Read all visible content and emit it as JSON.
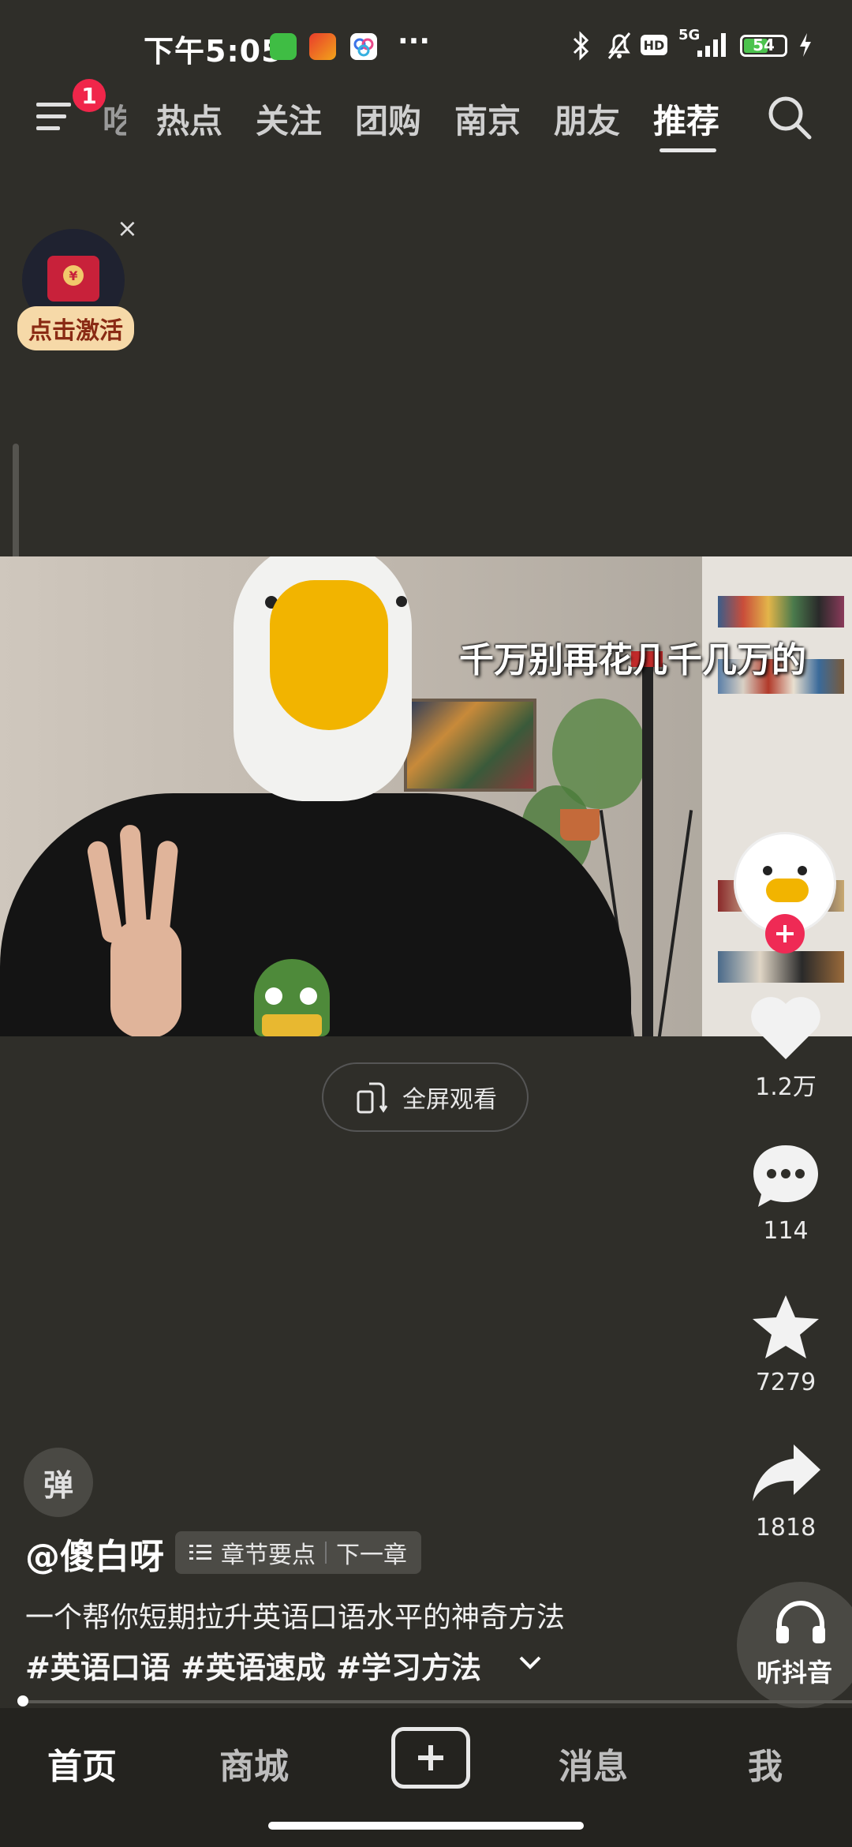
{
  "status_bar": {
    "time": "下午5:05",
    "more": "···",
    "network": "5G",
    "battery": "54"
  },
  "top_nav": {
    "badge": "1",
    "partial_tab": "吃",
    "tabs": [
      "热点",
      "关注",
      "团购",
      "南京",
      "朋友",
      "推荐"
    ],
    "active_tab": "推荐"
  },
  "red_packet": {
    "label": "点击激活",
    "close": "×",
    "symbol": "¥"
  },
  "video": {
    "subtitle": "千万别再花几千几万的"
  },
  "fullscreen": {
    "label": "全屏观看"
  },
  "rail": {
    "likes": "1.2万",
    "comments": "114",
    "favorites": "7279",
    "shares": "1818",
    "listen_label": "听抖音"
  },
  "info": {
    "danmu": "弹",
    "author": "@傻白呀",
    "chapter_points": "章节要点",
    "next_chapter": "下一章",
    "description": "一个帮你短期拉升英语口语水平的神奇方法",
    "hashtags": "#英语口语 #英语速成 #学习方法"
  },
  "bottom_nav": {
    "home": "首页",
    "mall": "商城",
    "messages": "消息",
    "me": "我"
  },
  "colors": {
    "background": "#2f2e29",
    "badge_red": "#f0264a",
    "follow_red": "#ef2a55",
    "duck_yellow": "#f2b400"
  }
}
